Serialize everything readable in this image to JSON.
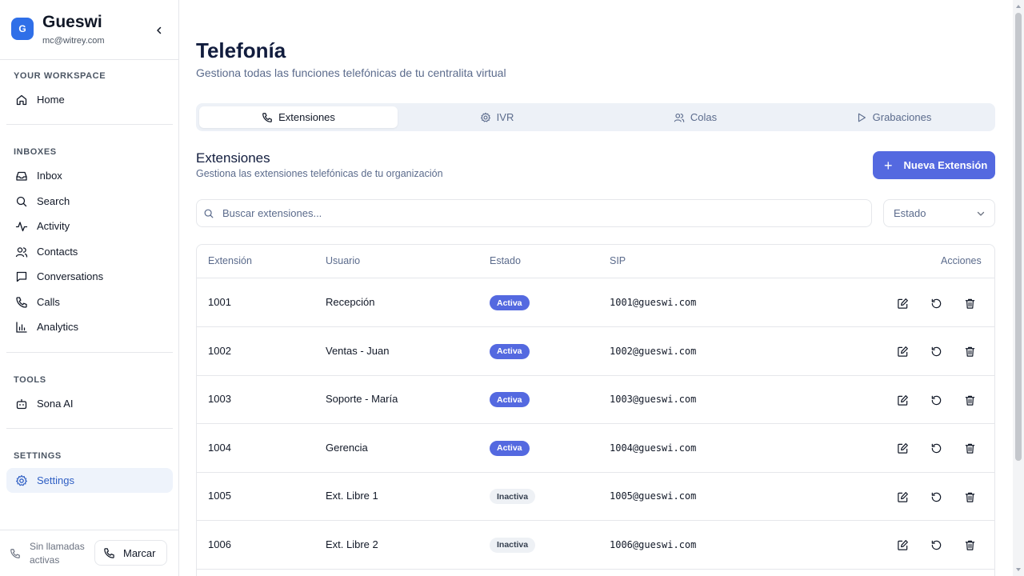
{
  "sidebar": {
    "brand": {
      "logo_letter": "G",
      "name": "Gueswi",
      "email": "mc@witrey.com"
    },
    "sections": {
      "workspace": "YOUR WORKSPACE",
      "inboxes": "INBOXES",
      "tools": "TOOLS",
      "settings": "SETTINGS"
    },
    "items": {
      "home": {
        "label": "Home",
        "icon": "home-icon"
      },
      "inbox": {
        "label": "Inbox",
        "icon": "inbox-icon"
      },
      "search": {
        "label": "Search",
        "icon": "search-icon"
      },
      "activity": {
        "label": "Activity",
        "icon": "activity-icon"
      },
      "contacts": {
        "label": "Contacts",
        "icon": "users-icon"
      },
      "conversations": {
        "label": "Conversations",
        "icon": "message-icon"
      },
      "calls": {
        "label": "Calls",
        "icon": "phone-icon"
      },
      "analytics": {
        "label": "Analytics",
        "icon": "chart-icon"
      },
      "sona_ai": {
        "label": "Sona AI",
        "icon": "bot-icon"
      },
      "settings": {
        "label": "Settings",
        "icon": "gear-icon",
        "active": true
      }
    },
    "footer": {
      "call_status": "Sin llamadas activas",
      "dial_label": "Marcar"
    }
  },
  "main": {
    "title": "Telefonía",
    "subtitle": "Gestiona todas las funciones telefónicas de tu centralita virtual",
    "tabs": [
      {
        "label": "Extensiones",
        "icon": "phone-icon",
        "active": true
      },
      {
        "label": "IVR",
        "icon": "gear-icon",
        "active": false
      },
      {
        "label": "Colas",
        "icon": "users-icon",
        "active": false
      },
      {
        "label": "Grabaciones",
        "icon": "play-icon",
        "active": false
      }
    ],
    "section_title": "Extensiones",
    "section_subtitle": "Gestiona las extensiones telefónicas de tu organización",
    "new_button": "Nueva Extensión",
    "search_placeholder": "Buscar extensiones...",
    "status_filter": "Estado",
    "table": {
      "headers": [
        "Extensión",
        "Usuario",
        "Estado",
        "SIP",
        "Acciones"
      ],
      "rows": [
        {
          "ext": "1001",
          "user": "Recepción",
          "status": "Activa",
          "sip": "1001@gueswi.com"
        },
        {
          "ext": "1002",
          "user": "Ventas - Juan",
          "status": "Activa",
          "sip": "1002@gueswi.com"
        },
        {
          "ext": "1003",
          "user": "Soporte - María",
          "status": "Activa",
          "sip": "1003@gueswi.com"
        },
        {
          "ext": "1004",
          "user": "Gerencia",
          "status": "Activa",
          "sip": "1004@gueswi.com"
        },
        {
          "ext": "1005",
          "user": "Ext. Libre 1",
          "status": "Inactiva",
          "sip": "1005@gueswi.com"
        },
        {
          "ext": "1006",
          "user": "Ext. Libre 2",
          "status": "Inactiva",
          "sip": "1006@gueswi.com"
        }
      ]
    }
  },
  "colors": {
    "accent": "#5469e0",
    "brand": "#2f6fe8",
    "active_nav_bg": "#eef3fb"
  }
}
